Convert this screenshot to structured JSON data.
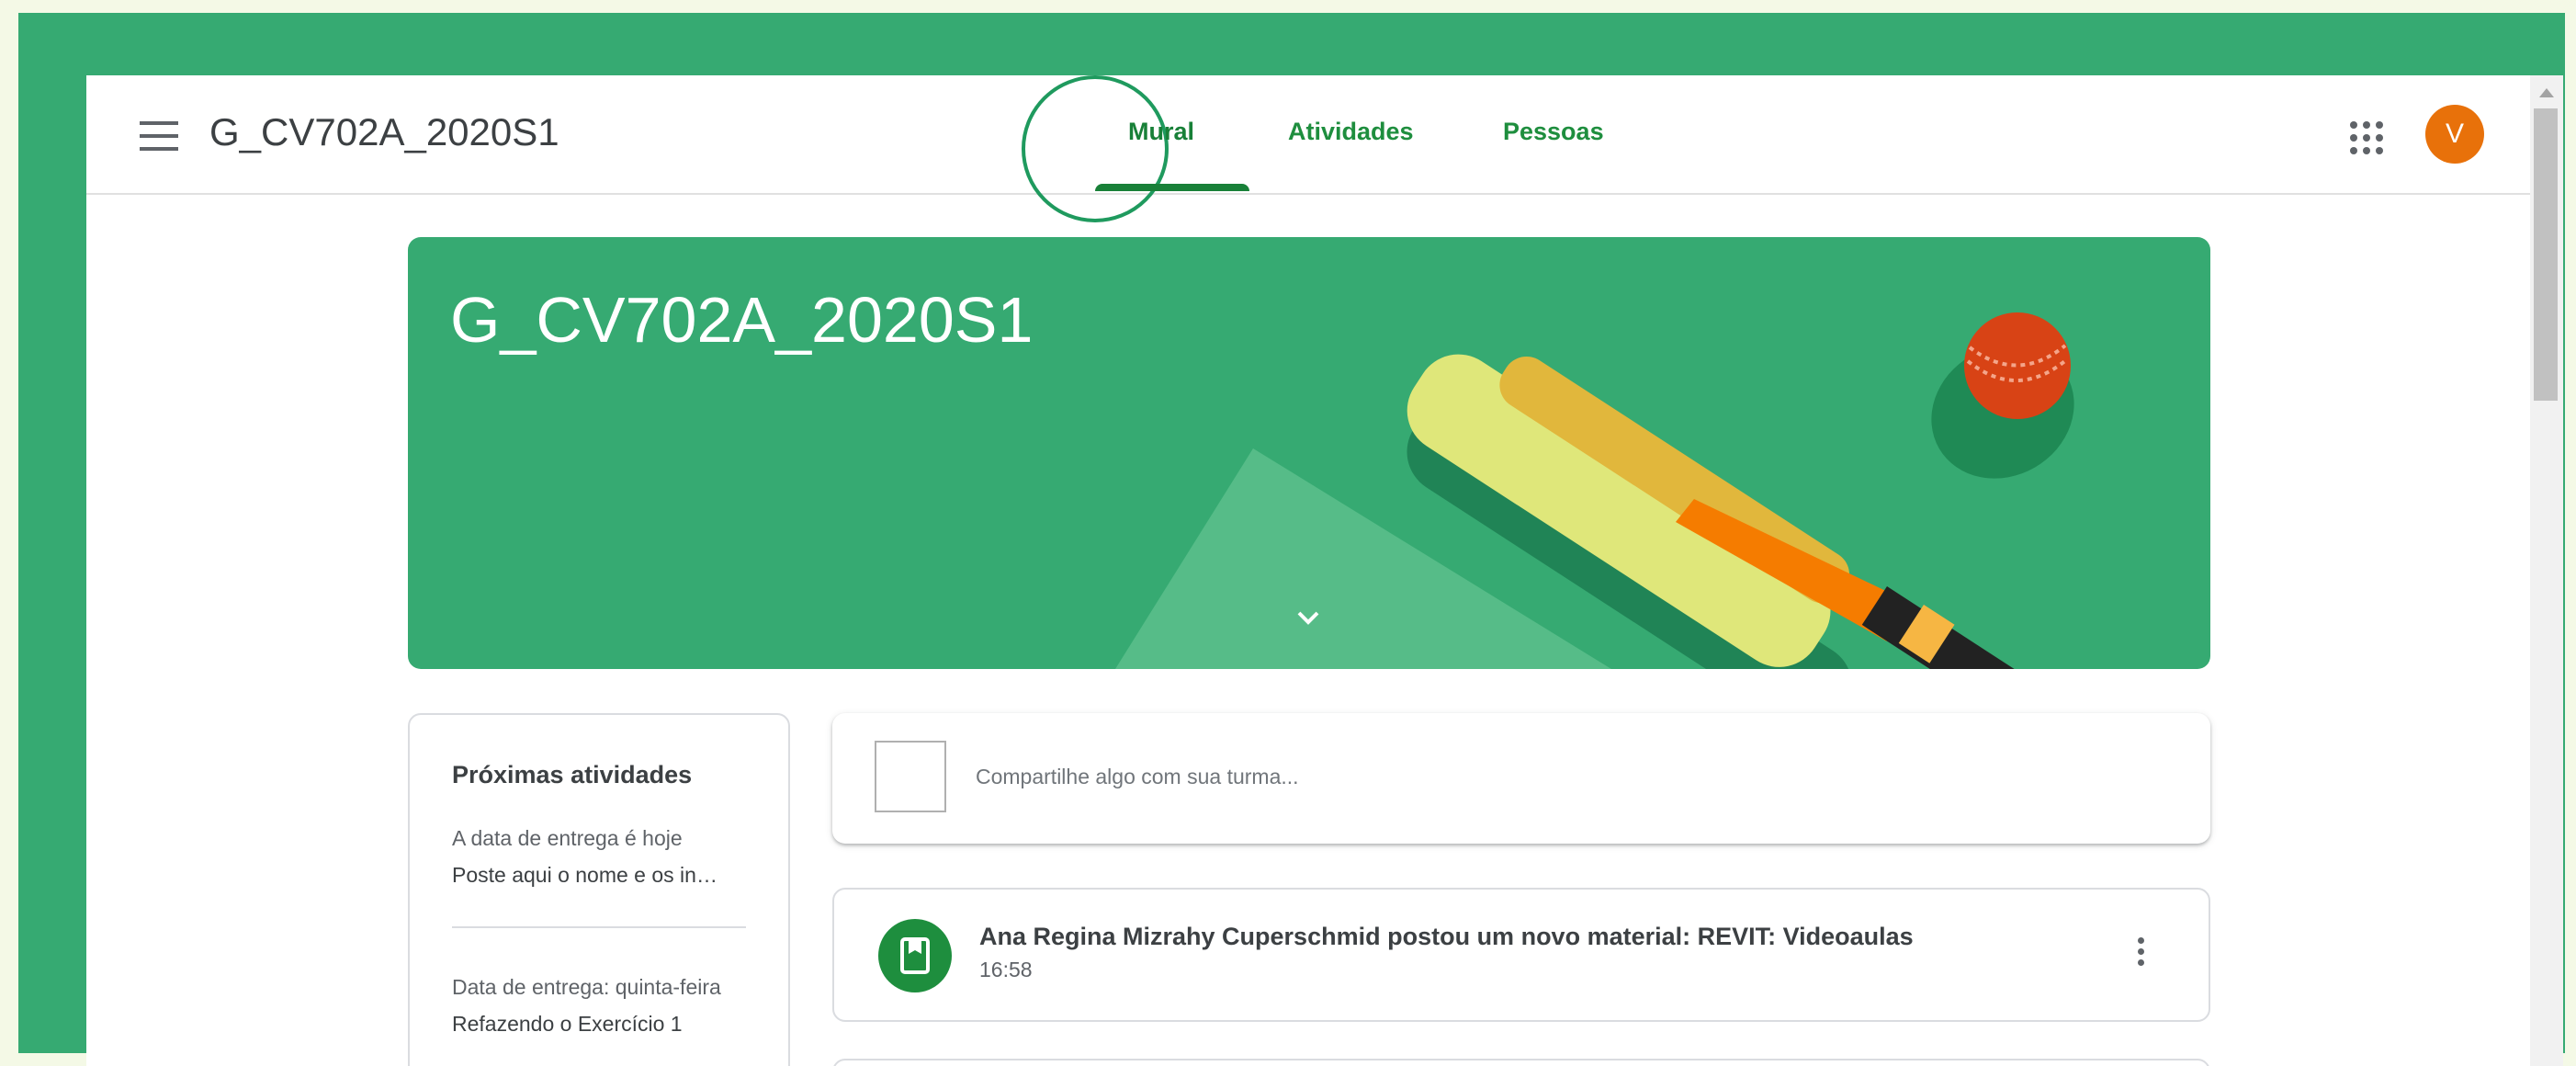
{
  "header": {
    "class_name": "G_CV702A_2020S1",
    "tabs": [
      {
        "label": "Mural",
        "active": true
      },
      {
        "label": "Atividades",
        "active": false
      },
      {
        "label": "Pessoas",
        "active": false
      }
    ],
    "avatar_initial": "V",
    "menu_icon": "hamburger-menu-icon",
    "apps_icon": "google-apps-icon",
    "avatar_color": "#e8710a"
  },
  "banner": {
    "title": "G_CV702A_2020S1",
    "theme": "cricket-bat-and-ball",
    "color": "#36aa72",
    "expand_icon": "chevron-down-icon"
  },
  "upcoming": {
    "title": "Próximas atividades",
    "items": [
      {
        "due": "A data de entrega é hoje",
        "name": "Poste aqui o nome e os in…"
      },
      {
        "due": "Data de entrega: quinta-feira",
        "name": "Refazendo o Exercício 1"
      }
    ]
  },
  "share": {
    "placeholder": "Compartilhe algo com sua turma..."
  },
  "posts": [
    {
      "title": "Ana Regina Mizrahy Cuperschmid postou um novo material: REVIT: Videoaulas",
      "time": "16:58",
      "icon": "material-book-icon",
      "more_icon": "more-vert-icon"
    }
  ],
  "colors": {
    "accent": "#1e8e3e",
    "frame": "#36aa72"
  }
}
